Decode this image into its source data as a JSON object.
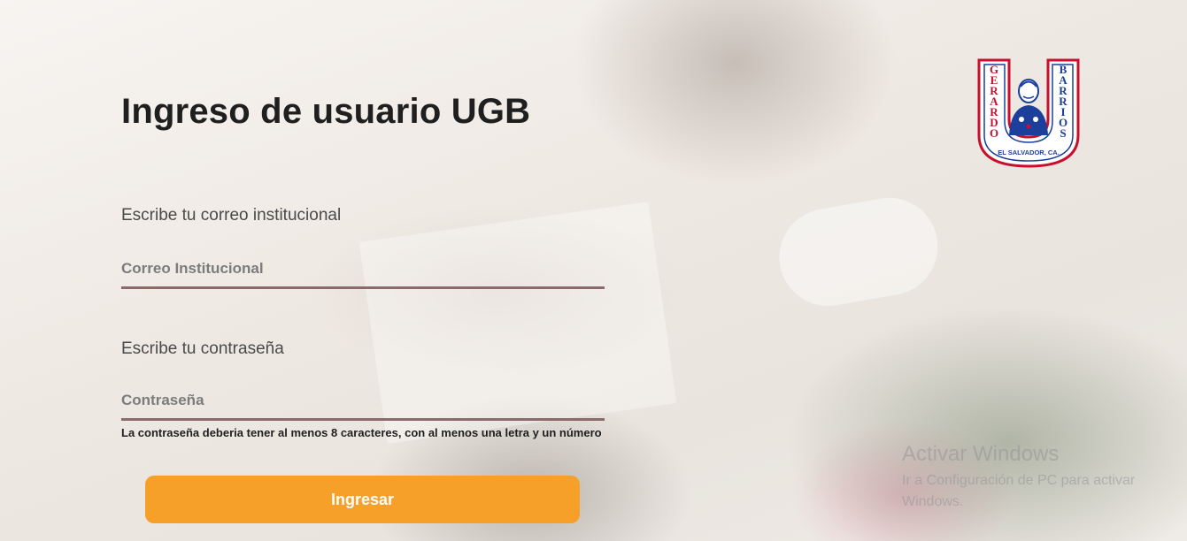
{
  "login": {
    "title": "Ingreso de usuario UGB",
    "email_label": "Escribe tu correo institucional",
    "email_placeholder": "Correo Institucional",
    "email_value": "",
    "password_label": "Escribe tu contraseña",
    "password_placeholder": "Contraseña",
    "password_value": "",
    "password_hint": "La contraseña deberia tener al menos 8 caracteres, con al menos una letra y un número",
    "submit_label": "Ingresar"
  },
  "logo": {
    "left_text": "GERARDO",
    "right_text": "BARRIOS",
    "bottom_text": "EL SALVADOR, CA."
  },
  "watermark": {
    "title": "Activar Windows",
    "subtitle": "Ir a Configuración de PC para activar Windows."
  },
  "colors": {
    "accent": "#f6a02a",
    "input_underline": "#8a6a6a",
    "logo_red": "#c8102e",
    "logo_blue": "#1b3f9a"
  },
  "icons": {
    "logo": "university-shield-logo"
  }
}
